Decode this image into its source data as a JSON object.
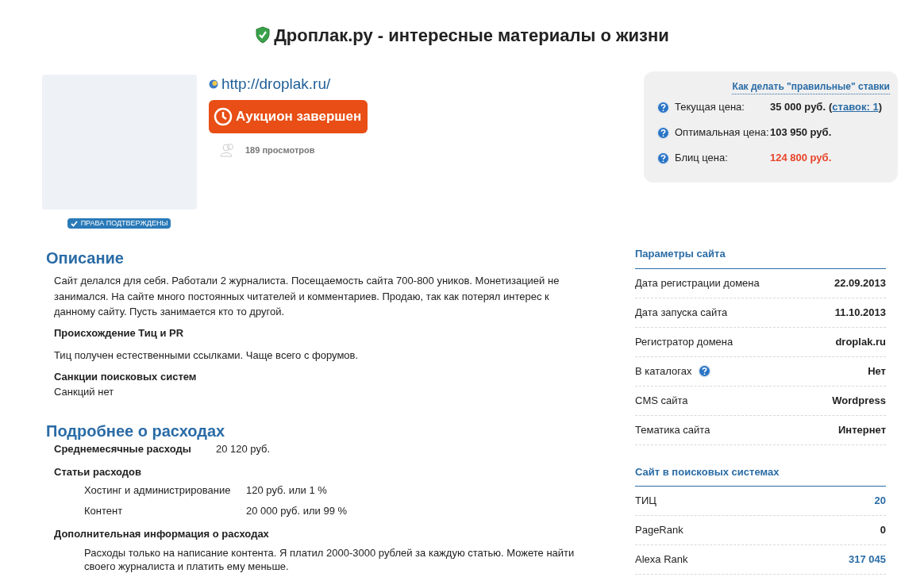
{
  "title": "Дроплак.ру - интересные материалы о жизни",
  "site": {
    "url": "http://droplak.ru/",
    "status_button": "Аукцион завершен",
    "views": "189 просмотров",
    "rights_badge": "ПРАВА ПОДТВЕРЖДЕНЫ"
  },
  "prices": {
    "help_link": "Как делать \"правильные\" ставки",
    "rows": [
      {
        "label": "Текущая цена:",
        "value": "35 000 руб.",
        "bids_open": "(",
        "bids_link": "ставок: 1",
        "bids_close": ")",
        "kind": "normal"
      },
      {
        "label": "Оптимальная цена:",
        "value": "103 950 руб.",
        "kind": "normal"
      },
      {
        "label": "Блиц цена:",
        "value": "124 800 руб.",
        "kind": "highlight"
      }
    ]
  },
  "description": {
    "heading": "Описание",
    "text": "Сайт делался для себя. Работали 2 журналиста. Посещаемость сайта 700-800 уников. Монетизацией не занимался. На сайте много постоянных читателей и комментариев. Продаю, так как потерял интерес к данному сайту. Пусть занимается кто то другой.",
    "subsections": [
      {
        "heading": "Происхождение Тиц и PR",
        "text": "Тиц получен естественными ссылками. Чаще всего с форумов.",
        "kind": "spaced"
      },
      {
        "heading": "Санкции поисковых систем",
        "text": "Санкций нет",
        "kind": "tight"
      }
    ]
  },
  "expenses": {
    "heading": "Подробнее о расходах",
    "monthly_label": "Среднемесячные расходы",
    "monthly_value": "20 120 руб.",
    "items_heading": "Статьи расходов",
    "items": [
      {
        "name": "Хостинг и администрирование",
        "value": "120 руб. или 1 %"
      },
      {
        "name": "Контент",
        "value": "20 000 руб. или 99 %"
      }
    ],
    "extra_heading": "Дополнительная информация о расходах",
    "extra_text": "Расходы только на написание контента. Я платил 2000-3000 рублей за каждую статью. Можете найти своего журналиста и платить ему меньше."
  },
  "params": {
    "heading": "Параметры сайта",
    "rows": [
      {
        "label": "Дата регистрации домена",
        "value": "22.09.2013",
        "help": false,
        "kind": "plain"
      },
      {
        "label": "Дата запуска сайта",
        "value": "11.10.2013",
        "help": false,
        "kind": "plain"
      },
      {
        "label": "Регистратор домена",
        "value": "droplak.ru",
        "help": false,
        "kind": "plain"
      },
      {
        "label": "В каталогах",
        "value": "Нет",
        "help": true,
        "kind": "plain"
      },
      {
        "label": "CMS сайта",
        "value": "Wordpress",
        "help": false,
        "kind": "plain"
      },
      {
        "label": "Тематика сайта",
        "value": "Интернет",
        "help": false,
        "kind": "plain"
      }
    ]
  },
  "search_engines": {
    "heading": "Сайт в поисковых системах",
    "rows": [
      {
        "label": "ТИЦ",
        "value": "20",
        "help": false,
        "kind": "link"
      },
      {
        "label": "PageRank",
        "value": "0",
        "help": false,
        "kind": "plain"
      },
      {
        "label": "Alexa Rank",
        "value": "317 045",
        "help": false,
        "kind": "link"
      }
    ]
  }
}
